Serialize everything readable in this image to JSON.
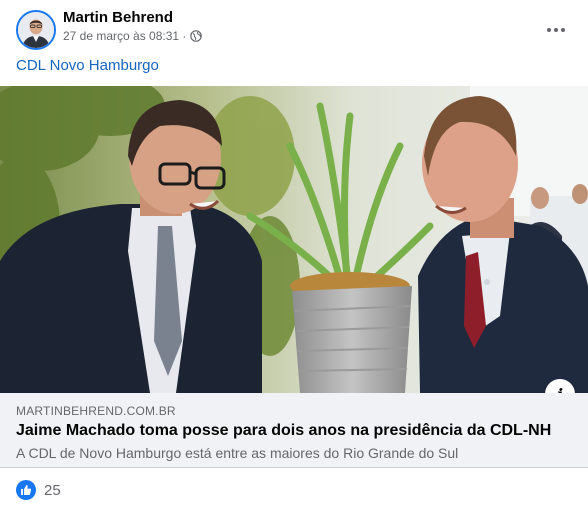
{
  "post": {
    "author": "Martin Behrend",
    "timestamp": "27 de março às 08:31 ·",
    "privacy_icon": "globe-icon",
    "text": "CDL Novo Hamburgo",
    "more_icon": "more-options-icon"
  },
  "link_preview": {
    "domain": "MARTINBEHREND.COM.BR",
    "title": "Jaime Machado toma posse para dois anos na presidência da CDL-NH",
    "description": "A CDL de Novo Hamburgo está entre as maiores do Rio Grande do Sul",
    "info_label": "i"
  },
  "reactions": {
    "icon": "like-icon",
    "count": "25"
  },
  "colors": {
    "accent": "#1877f2",
    "link_text": "#1565c0",
    "link_box_bg": "#f0f2f5",
    "secondary_text": "#65676b"
  }
}
